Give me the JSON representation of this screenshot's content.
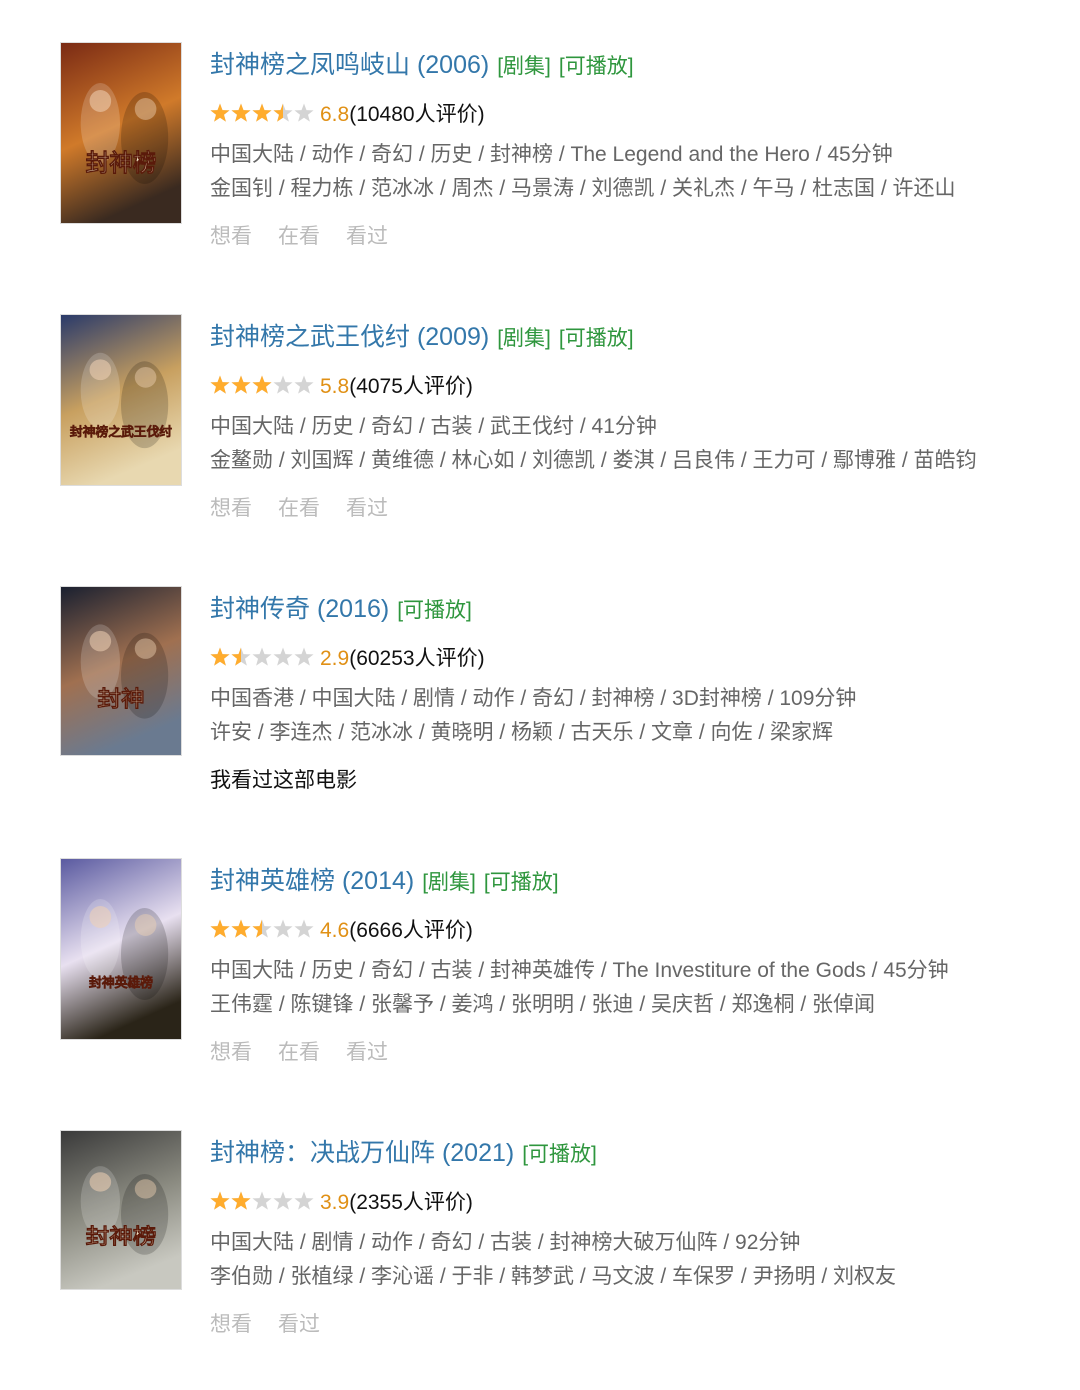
{
  "items": [
    {
      "title": "封神榜之凤鸣岐山 (2006)",
      "tags": [
        "[剧集]",
        "[可播放]"
      ],
      "rating_value": 6.8,
      "score": "6.8",
      "votes": "(10480人评价)",
      "genres": "中国大陆 / 动作 / 奇幻 / 历史 / 封神榜 / The Legend and the Hero / 45分钟",
      "cast": "金国钊 / 程力栋 / 范冰冰 / 周杰 / 马景涛 / 刘德凯 / 关礼杰 / 午马 / 杜志国 / 许还山",
      "actions": [
        "想看",
        "在看",
        "看过"
      ],
      "poster_caption": "封神榜",
      "colors": [
        "#7a2a14",
        "#d07a2a",
        "#3a2a20"
      ]
    },
    {
      "title": "封神榜之武王伐纣 (2009)",
      "tags": [
        "[剧集]",
        "[可播放]"
      ],
      "rating_value": 5.8,
      "score": "5.8",
      "votes": "(4075人评价)",
      "genres": "中国大陆 / 历史 / 奇幻 / 古装 / 武王伐纣 / 41分钟",
      "cast": "金鳌勋 / 刘国辉 / 黄维德 / 林心如 / 刘德凯 / 娄淇 / 吕良伟 / 王力可 / 鄢博雅 / 苗皓钧",
      "actions": [
        "想看",
        "在看",
        "看过"
      ],
      "poster_caption": "封神榜之武王伐纣",
      "colors": [
        "#2a3a6a",
        "#c8a060",
        "#e8d8b0"
      ]
    },
    {
      "title": "封神传奇 (2016)",
      "tags": [
        "[可播放]"
      ],
      "rating_value": 2.9,
      "score": "2.9",
      "votes": "(60253人评价)",
      "genres": "中国香港 / 中国大陆 / 剧情 / 动作 / 奇幻 / 封神榜 / 3D封神榜 / 109分钟",
      "cast": "许安 / 李连杰 / 范冰冰 / 黄晓明 / 杨颖 / 古天乐 / 文章 / 向佐 / 梁家辉",
      "status": "我看过这部电影",
      "actions": [],
      "poster_caption": "封神",
      "colors": [
        "#1a2030",
        "#a07050",
        "#6a7a90"
      ]
    },
    {
      "title": "封神英雄榜 (2014)",
      "tags": [
        "[剧集]",
        "[可播放]"
      ],
      "rating_value": 4.6,
      "score": "4.6",
      "votes": "(6666人评价)",
      "genres": "中国大陆 / 历史 / 奇幻 / 古装 / 封神英雄传 / The Investiture of the Gods / 45分钟",
      "cast": "王伟霆 / 陈键锋 / 张馨予 / 姜鸿 / 张明明 / 张迪 / 吴庆哲 / 郑逸桐 / 张倬闻",
      "actions": [
        "想看",
        "在看",
        "看过"
      ],
      "poster_caption": "封神英雄榜",
      "colors": [
        "#5a5aa0",
        "#e8e0f0",
        "#2a2418"
      ]
    },
    {
      "title": "封神榜：决战万仙阵 (2021)",
      "tags": [
        "[可播放]"
      ],
      "rating_value": 3.9,
      "score": "3.9",
      "votes": "(2355人评价)",
      "genres": "中国大陆 / 剧情 / 动作 / 奇幻 / 古装 / 封神榜大破万仙阵 / 92分钟",
      "cast": "李伯勋 / 张植绿 / 李沁谣 / 于非 / 韩梦武 / 马文波 / 车保罗 / 尹扬明 / 刘权友",
      "actions": [
        "想看",
        "看过"
      ],
      "poster_caption": "封神榜",
      "colors": [
        "#3a3a3a",
        "#8a8a80",
        "#c8c8c0"
      ]
    }
  ]
}
